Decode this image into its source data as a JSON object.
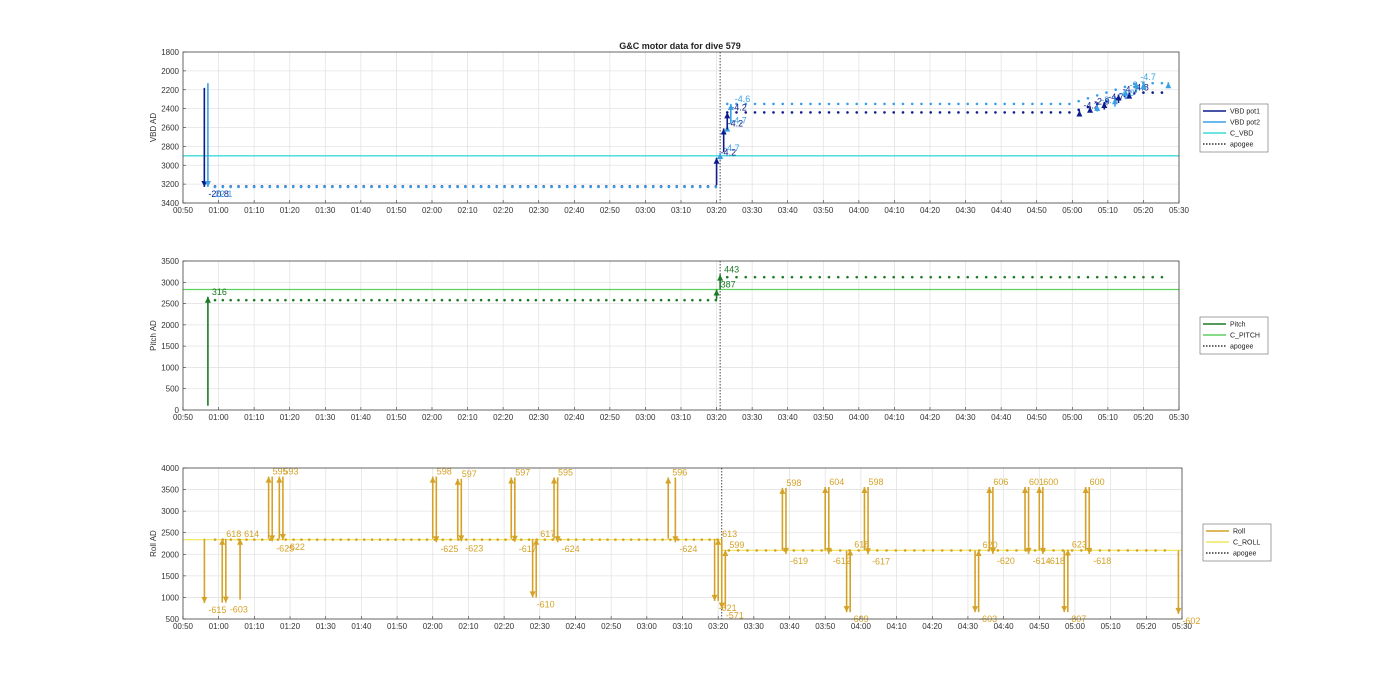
{
  "figure": {
    "title": "G&C motor data for dive 579"
  },
  "chart_data": [
    {
      "type": "scatter",
      "id": "vbd",
      "ylabel": "VBD AD",
      "xlim": [
        "00:50",
        "05:30"
      ],
      "ylim": [
        1800,
        3400
      ],
      "y_reversed": true,
      "grid": true,
      "legend_position": "right",
      "x_ticks": [
        "00:50",
        "01:00",
        "01:10",
        "01:20",
        "01:30",
        "01:40",
        "01:50",
        "02:00",
        "02:10",
        "02:20",
        "02:30",
        "02:40",
        "02:50",
        "03:00",
        "03:10",
        "03:20",
        "03:30",
        "03:40",
        "03:50",
        "04:00",
        "04:10",
        "04:20",
        "04:30",
        "04:40",
        "04:50",
        "05:00",
        "05:10",
        "05:20",
        "05:30"
      ],
      "y_ticks": [
        1800,
        2000,
        2200,
        2400,
        2600,
        2800,
        3000,
        3200,
        3400
      ],
      "legend": [
        {
          "name": "VBD pot1",
          "color": "#0d1c8c",
          "style": "solid"
        },
        {
          "name": "VBD pot2",
          "color": "#3aa0e6",
          "style": "solid"
        },
        {
          "name": "C_VBD",
          "color": "#3ddad9",
          "style": "solid"
        },
        {
          "name": "apogee",
          "color": "#333333",
          "style": "dotted"
        }
      ],
      "hlines": [
        {
          "y": 2900,
          "color": "#3ddad9"
        }
      ],
      "apogee": "03:21",
      "series": [
        {
          "name": "VBD pot1",
          "color": "#0d1c8c",
          "first": "00:59",
          "last": "03:20",
          "y_before": 3225,
          "y_after": 2440,
          "y_end": 2230
        },
        {
          "name": "VBD pot2",
          "color": "#3aa0e6",
          "first": "00:59",
          "last": "03:20",
          "y_before": 3230,
          "y_after": 2350,
          "y_end": 2130
        }
      ],
      "events": [
        {
          "t": "00:56",
          "y0": 2180,
          "y1": 3230,
          "color": "#0d1c8c",
          "label": "-20.8",
          "head": "down"
        },
        {
          "t": "00:57",
          "y0": 2130,
          "y1": 3230,
          "color": "#3aa0e6",
          "label": "-22.1",
          "head": "down"
        },
        {
          "t": "03:20",
          "y0": 3210,
          "y1": 2920,
          "color": "#0d1c8c",
          "label": "-4.2",
          "head": "up"
        },
        {
          "t": "03:21",
          "y0": 2940,
          "y1": 2870,
          "color": "#3aa0e6",
          "label": "-4.7",
          "head": "up"
        },
        {
          "t": "03:22",
          "y0": 2860,
          "y1": 2610,
          "color": "#0d1c8c",
          "label": "-4.2",
          "head": "up"
        },
        {
          "t": "03:23",
          "y0": 2640,
          "y1": 2580,
          "color": "#3aa0e6",
          "label": "-4.7",
          "head": "up"
        },
        {
          "t": "03:23",
          "y0": 2620,
          "y1": 2440,
          "color": "#0d1c8c",
          "label": "-4.2",
          "head": "up"
        },
        {
          "t": "03:24",
          "y0": 2560,
          "y1": 2350,
          "color": "#3aa0e6",
          "label": "-4.6",
          "head": "up"
        },
        {
          "t": "05:02",
          "y0": 2460,
          "y1": 2420,
          "color": "#0d1c8c",
          "label": "-4.2",
          "head": "up"
        },
        {
          "t": "05:05",
          "y0": 2440,
          "y1": 2380,
          "color": "#0d1c8c",
          "label": "-2.9",
          "head": "up"
        },
        {
          "t": "05:07",
          "y0": 2430,
          "y1": 2360,
          "color": "#3aa0e6",
          "label": "-3.7",
          "head": "up"
        },
        {
          "t": "05:09",
          "y0": 2410,
          "y1": 2330,
          "color": "#0d1c8c",
          "label": "-4.7",
          "head": "up"
        },
        {
          "t": "05:12",
          "y0": 2380,
          "y1": 2290,
          "color": "#3aa0e6",
          "label": "-4.0",
          "head": "up"
        },
        {
          "t": "05:13",
          "y0": 2340,
          "y1": 2250,
          "color": "#0d1c8c",
          "label": "-4.7",
          "head": "up"
        },
        {
          "t": "05:15",
          "y0": 2300,
          "y1": 2200,
          "color": "#3aa0e6",
          "label": "-3.7",
          "head": "up"
        },
        {
          "t": "05:16",
          "y0": 2290,
          "y1": 2230,
          "color": "#0d1c8c",
          "label": "-4.8",
          "head": "up"
        },
        {
          "t": "05:18",
          "y0": 2230,
          "y1": 2120,
          "color": "#3aa0e6",
          "label": "-4.7",
          "head": "up"
        },
        {
          "t": "05:20",
          "y0": 2200,
          "y1": 2130,
          "color": "#3aa0e6",
          "label": "",
          "head": "up"
        },
        {
          "t": "05:27",
          "y0": 2170,
          "y1": 2120,
          "color": "#3aa0e6",
          "label": "",
          "head": "up"
        }
      ]
    },
    {
      "type": "scatter",
      "id": "pitch",
      "ylabel": "Pitch AD",
      "xlim": [
        "00:50",
        "05:30"
      ],
      "ylim": [
        0,
        3500
      ],
      "y_reversed": false,
      "grid": true,
      "legend_position": "right",
      "x_ticks": [
        "00:50",
        "01:00",
        "01:10",
        "01:20",
        "01:30",
        "01:40",
        "01:50",
        "02:00",
        "02:10",
        "02:20",
        "02:30",
        "02:40",
        "02:50",
        "03:00",
        "03:10",
        "03:20",
        "03:30",
        "03:40",
        "03:50",
        "04:00",
        "04:10",
        "04:20",
        "04:30",
        "04:40",
        "04:50",
        "05:00",
        "05:10",
        "05:20",
        "05:30"
      ],
      "y_ticks": [
        0,
        500,
        1000,
        1500,
        2000,
        2500,
        3000,
        3500
      ],
      "legend": [
        {
          "name": "Pitch",
          "color": "#1b7a24",
          "style": "solid"
        },
        {
          "name": "C_PITCH",
          "color": "#5ed15e",
          "style": "solid"
        },
        {
          "name": "apogee",
          "color": "#333333",
          "style": "dotted"
        }
      ],
      "hlines": [
        {
          "y": 2830,
          "color": "#5ed15e"
        }
      ],
      "apogee": "03:21",
      "series": [
        {
          "name": "Pitch",
          "color": "#1b7a24",
          "first": "00:59",
          "last": "03:20",
          "y_before": 2580,
          "y_after": 3120,
          "y_end": 3120
        }
      ],
      "events": [
        {
          "t": "00:57",
          "y0": 100,
          "y1": 2660,
          "color": "#1b7a24",
          "label": "316",
          "head": "up"
        },
        {
          "t": "03:20",
          "y0": 2600,
          "y1": 2830,
          "color": "#1b7a24",
          "label": "387",
          "head": "up"
        },
        {
          "t": "03:21",
          "y0": 2830,
          "y1": 3180,
          "color": "#1b7a24",
          "label": "443",
          "head": "up"
        }
      ]
    },
    {
      "type": "scatter",
      "id": "roll",
      "ylabel": "Roll AD",
      "xlim": [
        "00:50",
        "05:30"
      ],
      "ylim": [
        500,
        4000
      ],
      "y_reversed": false,
      "grid": true,
      "legend_position": "right",
      "x_ticks": [
        "00:50",
        "01:00",
        "01:10",
        "01:20",
        "01:30",
        "01:40",
        "01:50",
        "02:00",
        "02:10",
        "02:20",
        "02:30",
        "02:40",
        "02:50",
        "03:00",
        "03:10",
        "03:20",
        "03:30",
        "03:40",
        "03:50",
        "04:00",
        "04:10",
        "04:20",
        "04:30",
        "04:40",
        "04:50",
        "05:00",
        "05:10",
        "05:20",
        "05:30"
      ],
      "y_ticks": [
        500,
        1000,
        1500,
        2000,
        2500,
        3000,
        3500,
        4000
      ],
      "legend": [
        {
          "name": "Roll",
          "color": "#d4a227",
          "style": "solid"
        },
        {
          "name": "C_ROLL",
          "color": "#f2e861",
          "style": "solid"
        },
        {
          "name": "apogee",
          "color": "#333333",
          "style": "dotted"
        }
      ],
      "hlines": [
        {
          "y": 2340,
          "color": "#f2e861",
          "from": "00:50",
          "to": "03:21"
        },
        {
          "y": 2090,
          "color": "#f2e861",
          "from": "03:21",
          "to": "05:30"
        }
      ],
      "apogee": "03:21",
      "series": [
        {
          "name": "Roll",
          "color": "#d4a227",
          "first": "00:59",
          "last": "03:20",
          "y_before": 2340,
          "y_after": 2090,
          "y_end": 2090
        }
      ],
      "events": [
        {
          "t": "00:56",
          "y0": 2360,
          "y1": 870,
          "color": "#d4a227",
          "label": "-615",
          "head": "down"
        },
        {
          "t": "01:01",
          "y0": 880,
          "y1": 2360,
          "color": "#d4a227",
          "label": "618",
          "head": "up"
        },
        {
          "t": "01:02",
          "y0": 2360,
          "y1": 880,
          "color": "#d4a227",
          "label": "-603",
          "head": "down"
        },
        {
          "t": "01:06",
          "y0": 950,
          "y1": 2360,
          "color": "#d4a227",
          "label": "614",
          "head": "up"
        },
        {
          "t": "01:14",
          "y0": 2360,
          "y1": 3800,
          "color": "#d4a227",
          "label": "595",
          "head": "up"
        },
        {
          "t": "01:15",
          "y0": 3800,
          "y1": 2300,
          "color": "#d4a227",
          "label": "-625",
          "head": "down"
        },
        {
          "t": "01:17",
          "y0": 2360,
          "y1": 3800,
          "color": "#d4a227",
          "label": "593",
          "head": "up"
        },
        {
          "t": "01:18",
          "y0": 3800,
          "y1": 2330,
          "color": "#d4a227",
          "label": "-622",
          "head": "down"
        },
        {
          "t": "02:00",
          "y0": 2360,
          "y1": 3800,
          "color": "#d4a227",
          "label": "598",
          "head": "up"
        },
        {
          "t": "02:01",
          "y0": 3800,
          "y1": 2280,
          "color": "#d4a227",
          "label": "-625",
          "head": "down"
        },
        {
          "t": "02:07",
          "y0": 2360,
          "y1": 3750,
          "color": "#d4a227",
          "label": "597",
          "head": "up"
        },
        {
          "t": "02:08",
          "y0": 3750,
          "y1": 2300,
          "color": "#d4a227",
          "label": "-623",
          "head": "down"
        },
        {
          "t": "02:22",
          "y0": 2360,
          "y1": 3780,
          "color": "#d4a227",
          "label": "597",
          "head": "up"
        },
        {
          "t": "02:23",
          "y0": 3780,
          "y1": 2290,
          "color": "#d4a227",
          "label": "-617",
          "head": "down"
        },
        {
          "t": "02:28",
          "y0": 2360,
          "y1": 1000,
          "color": "#d4a227",
          "label": "-610",
          "head": "down"
        },
        {
          "t": "02:29",
          "y0": 1000,
          "y1": 2360,
          "color": "#d4a227",
          "label": "617",
          "head": "up"
        },
        {
          "t": "02:34",
          "y0": 2360,
          "y1": 3780,
          "color": "#d4a227",
          "label": "595",
          "head": "up"
        },
        {
          "t": "02:35",
          "y0": 3780,
          "y1": 2280,
          "color": "#d4a227",
          "label": "-624",
          "head": "down"
        },
        {
          "t": "03:06",
          "y0": 2360,
          "y1": 3780,
          "color": "#d4a227",
          "label": "596",
          "head": "up"
        },
        {
          "t": "03:08",
          "y0": 3780,
          "y1": 2280,
          "color": "#d4a227",
          "label": "-624",
          "head": "down"
        },
        {
          "t": "03:19",
          "y0": 2360,
          "y1": 920,
          "color": "#d4a227",
          "label": "-621",
          "head": "down"
        },
        {
          "t": "03:20",
          "y0": 920,
          "y1": 2360,
          "color": "#d4a227",
          "label": "613",
          "head": "up"
        },
        {
          "t": "03:21",
          "y0": 2360,
          "y1": 740,
          "color": "#d4a227",
          "label": "-571",
          "head": "down"
        },
        {
          "t": "03:22",
          "y0": 740,
          "y1": 2100,
          "color": "#d4a227",
          "label": "599",
          "head": "up"
        },
        {
          "t": "03:38",
          "y0": 2090,
          "y1": 3540,
          "color": "#d4a227",
          "label": "598",
          "head": "up"
        },
        {
          "t": "03:39",
          "y0": 3540,
          "y1": 2010,
          "color": "#d4a227",
          "label": "-619",
          "head": "down"
        },
        {
          "t": "03:50",
          "y0": 2090,
          "y1": 3560,
          "color": "#d4a227",
          "label": "604",
          "head": "up"
        },
        {
          "t": "03:51",
          "y0": 3560,
          "y1": 2010,
          "color": "#d4a227",
          "label": "-612",
          "head": "down"
        },
        {
          "t": "03:56",
          "y0": 2090,
          "y1": 660,
          "color": "#d4a227",
          "label": "-609",
          "head": "down"
        },
        {
          "t": "03:57",
          "y0": 660,
          "y1": 2110,
          "color": "#d4a227",
          "label": "618",
          "head": "up"
        },
        {
          "t": "04:01",
          "y0": 2090,
          "y1": 3560,
          "color": "#d4a227",
          "label": "598",
          "head": "up"
        },
        {
          "t": "04:02",
          "y0": 3560,
          "y1": 2000,
          "color": "#d4a227",
          "label": "-617",
          "head": "down"
        },
        {
          "t": "04:32",
          "y0": 2090,
          "y1": 660,
          "color": "#d4a227",
          "label": "-603",
          "head": "down"
        },
        {
          "t": "04:33",
          "y0": 660,
          "y1": 2100,
          "color": "#d4a227",
          "label": "620",
          "head": "up"
        },
        {
          "t": "04:36",
          "y0": 2090,
          "y1": 3560,
          "color": "#d4a227",
          "label": "606",
          "head": "up"
        },
        {
          "t": "04:37",
          "y0": 3560,
          "y1": 2010,
          "color": "#d4a227",
          "label": "-620",
          "head": "down"
        },
        {
          "t": "04:46",
          "y0": 2090,
          "y1": 3560,
          "color": "#d4a227",
          "label": "601",
          "head": "up"
        },
        {
          "t": "04:47",
          "y0": 3560,
          "y1": 2010,
          "color": "#d4a227",
          "label": "-614",
          "head": "down"
        },
        {
          "t": "04:50",
          "y0": 2090,
          "y1": 3560,
          "color": "#d4a227",
          "label": "600",
          "head": "up"
        },
        {
          "t": "04:51",
          "y0": 3560,
          "y1": 2010,
          "color": "#d4a227",
          "label": "-618",
          "head": "down"
        },
        {
          "t": "04:57",
          "y0": 2090,
          "y1": 660,
          "color": "#d4a227",
          "label": "-607",
          "head": "down"
        },
        {
          "t": "04:58",
          "y0": 660,
          "y1": 2110,
          "color": "#d4a227",
          "label": "623",
          "head": "up"
        },
        {
          "t": "05:03",
          "y0": 2090,
          "y1": 3560,
          "color": "#d4a227",
          "label": "600",
          "head": "up"
        },
        {
          "t": "05:04",
          "y0": 3560,
          "y1": 2010,
          "color": "#d4a227",
          "label": "-618",
          "head": "down"
        },
        {
          "t": "05:29",
          "y0": 2090,
          "y1": 620,
          "color": "#d4a227",
          "label": "-602",
          "head": "down"
        }
      ]
    }
  ]
}
